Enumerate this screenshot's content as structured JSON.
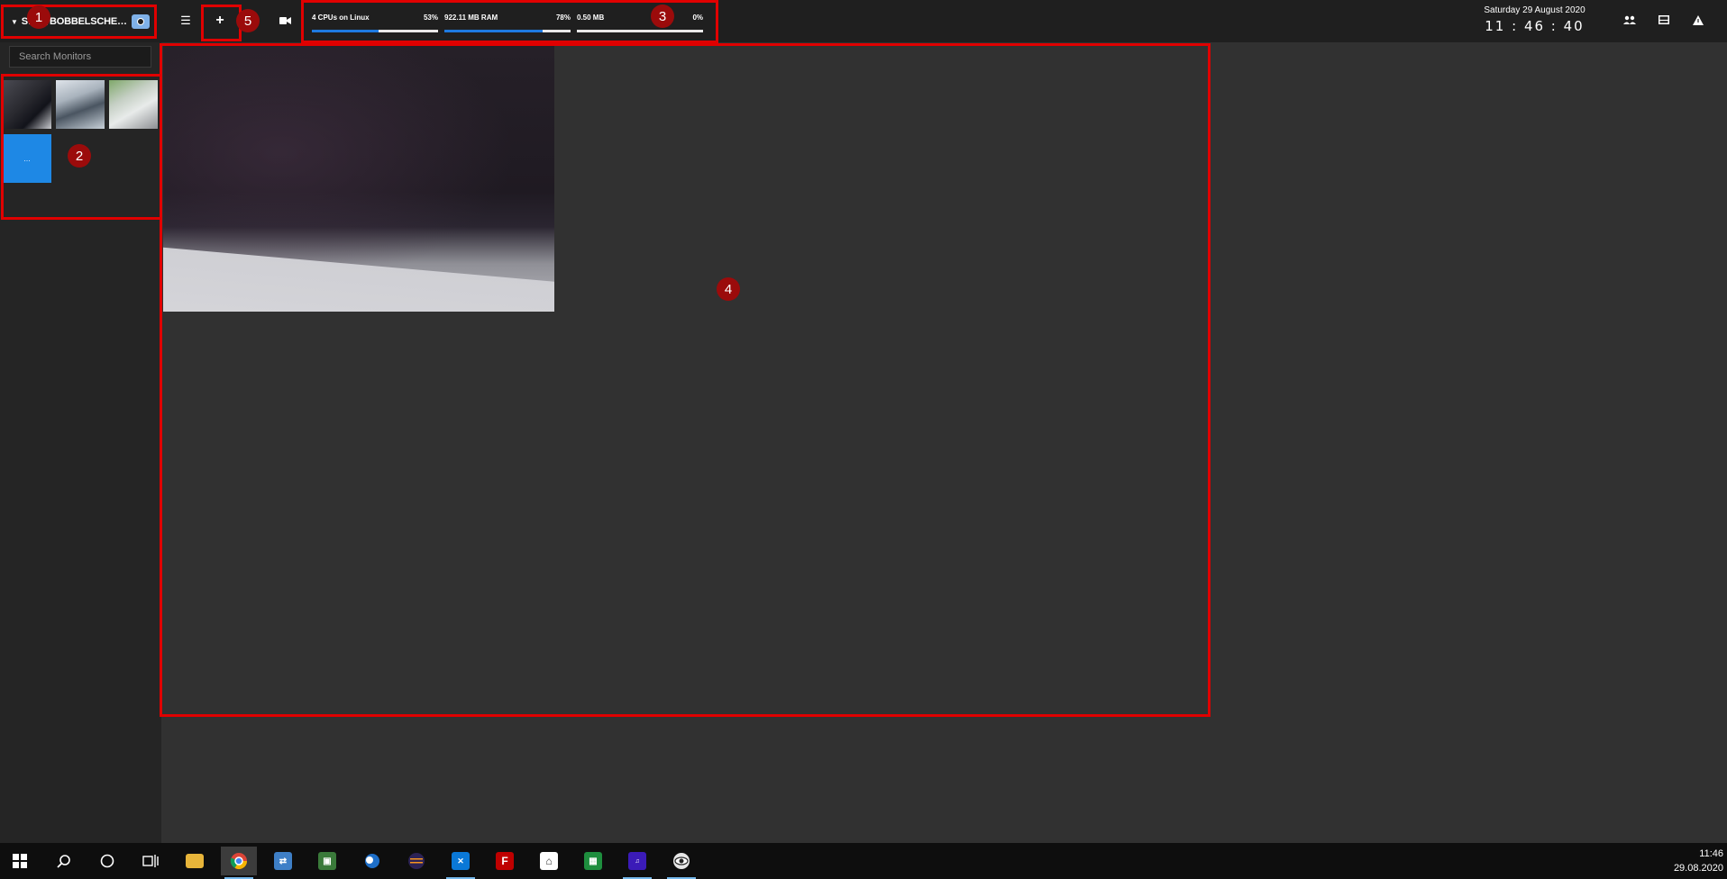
{
  "header": {
    "user_label": "S… @BOBBELSCHE…",
    "stats": {
      "cpu": {
        "label": "4 CPUs on Linux",
        "percent_text": "53%",
        "percent": 53
      },
      "ram": {
        "label": "922.11 MB RAM",
        "percent_text": "78%",
        "percent": 78
      },
      "network": {
        "label": "0.50 MB",
        "percent_text": "0%",
        "percent": 0
      }
    },
    "date": "Saturday 29 August 2020",
    "time": "11 : 46 : 40"
  },
  "sidebar": {
    "search_placeholder": "Search Monitors",
    "more_label": "..."
  },
  "annotations": {
    "n1": "1",
    "n2": "2",
    "n3": "3",
    "n4": "4",
    "n5": "5"
  },
  "taskbar": {
    "time": "11:46",
    "date": "29.08.2020"
  },
  "colors": {
    "accent": "#1e7ae0",
    "annotation": "#e00000",
    "background": "#313131",
    "topbar": "#1f1f1f"
  }
}
